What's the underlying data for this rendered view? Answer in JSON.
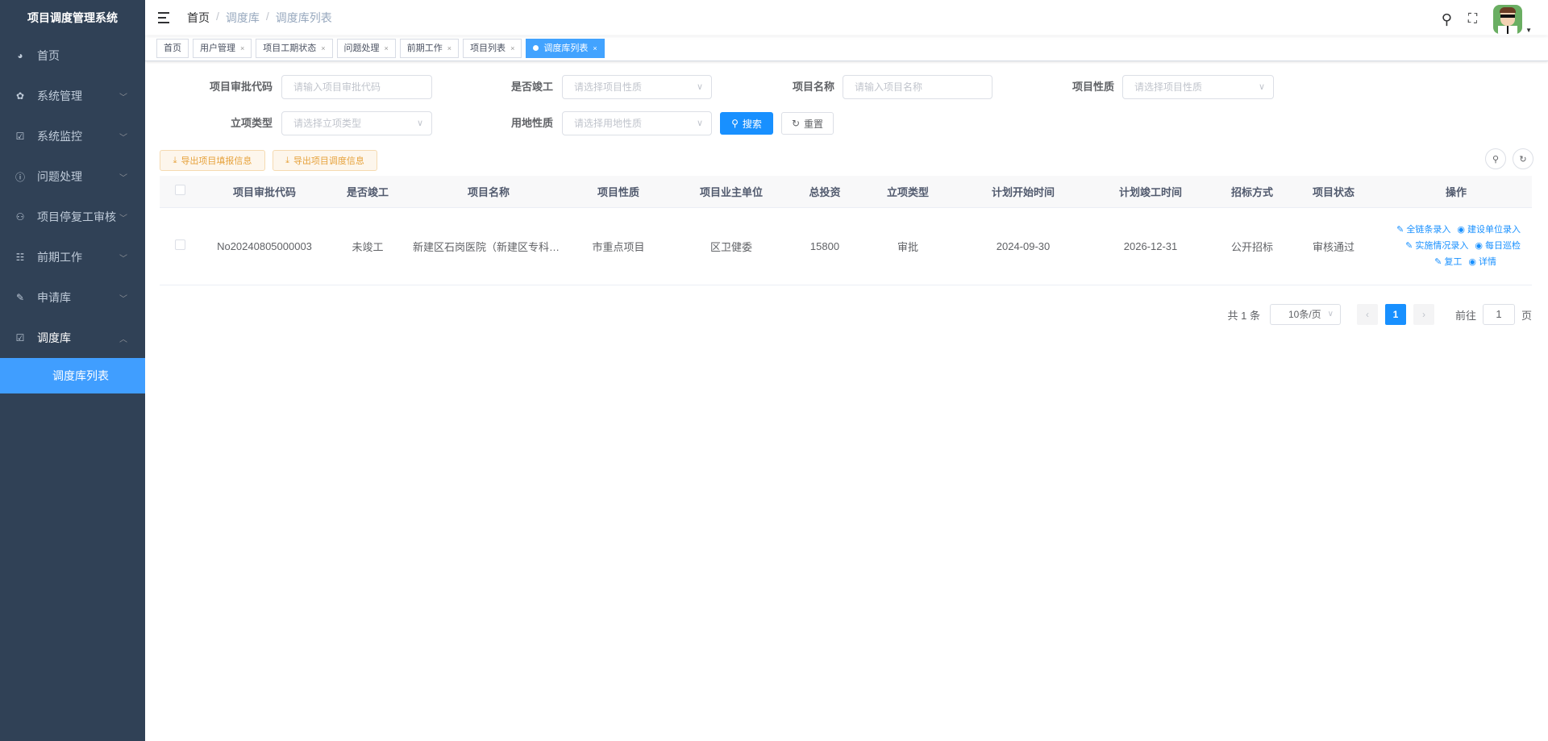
{
  "app": {
    "title": "项目调度管理系统"
  },
  "sidebar": {
    "items": [
      {
        "label": "首页",
        "icon": "dashboard-icon"
      },
      {
        "label": "系统管理",
        "icon": "gear-icon"
      },
      {
        "label": "系统监控",
        "icon": "monitor-icon"
      },
      {
        "label": "问题处理",
        "icon": "question-icon"
      },
      {
        "label": "项目停复工审核",
        "icon": "people-icon"
      },
      {
        "label": "前期工作",
        "icon": "form-icon"
      },
      {
        "label": "申请库",
        "icon": "edit-icon"
      },
      {
        "label": "调度库",
        "icon": "monitor-icon"
      }
    ],
    "sub_item": "调度库列表"
  },
  "breadcrumb": [
    "首页",
    "调度库",
    "调度库列表"
  ],
  "tags": [
    "首页",
    "用户管理",
    "项目工期状态",
    "问题处理",
    "前期工作",
    "项目列表",
    "调度库列表"
  ],
  "form": {
    "code": {
      "label": "项目审批代码",
      "placeholder": "请输入项目审批代码"
    },
    "completed": {
      "label": "是否竣工",
      "placeholder": "请选择项目性质"
    },
    "name": {
      "label": "项目名称",
      "placeholder": "请输入项目名称"
    },
    "nature": {
      "label": "项目性质",
      "placeholder": "请选择项目性质"
    },
    "type": {
      "label": "立项类型",
      "placeholder": "请选择立项类型"
    },
    "land": {
      "label": "用地性质",
      "placeholder": "请选择用地性质"
    },
    "search": "搜索",
    "reset": "重置"
  },
  "toolbar": {
    "export1": "导出项目填报信息",
    "export2": "导出项目调度信息"
  },
  "table": {
    "columns": [
      "项目审批代码",
      "是否竣工",
      "项目名称",
      "项目性质",
      "项目业主单位",
      "总投资",
      "立项类型",
      "计划开始时间",
      "计划竣工时间",
      "招标方式",
      "项目状态",
      "操作"
    ],
    "rows": [
      {
        "code": "No20240805000003",
        "completed": "未竣工",
        "name": "新建区石岗医院（新建区专科医院）",
        "nature": "市重点项目",
        "owner": "区卫健委",
        "investment": "15800",
        "type": "审批",
        "start": "2024-09-30",
        "end": "2026-12-31",
        "bidding": "公开招标",
        "status": "审核通过",
        "actions": [
          "全链条录入",
          "建设单位录入",
          "实施情况录入",
          "每日巡检",
          "复工",
          "详情"
        ]
      }
    ]
  },
  "pagination": {
    "total": "共 1 条",
    "page_size": "10条/页",
    "current": "1",
    "goto_label": "前往",
    "goto_value": "1",
    "page_suffix": "页"
  }
}
